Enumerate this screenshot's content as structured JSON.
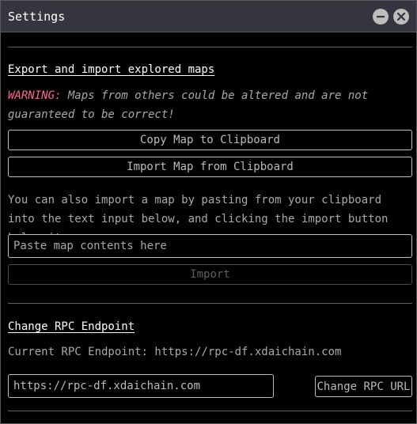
{
  "window": {
    "title": "Settings",
    "minimize_icon": "minus-icon",
    "close_icon": "close-icon"
  },
  "export_section": {
    "heading": "Export and import explored maps",
    "warning_label": "WARNING:",
    "warning_text": " Maps from others could be altered and are not guaranteed to be correct!",
    "copy_button": "Copy Map to Clipboard",
    "import_clipboard_button": "Import Map from Clipboard",
    "instructions": "You can also import a map by pasting from your clipboard into the text input below, and clicking the import button below it.",
    "paste_placeholder": "Paste map contents here",
    "import_button": "Import",
    "import_button_state": "disabled"
  },
  "rpc_section": {
    "heading": "Change RPC Endpoint",
    "current_label": "Current RPC Endpoint: https://rpc-df.xdaichain.com",
    "input_value": "https://rpc-df.xdaichain.com",
    "change_button": "Change RPC URL"
  },
  "colors": {
    "titlebar": "#35353f",
    "warning": "#ff6492",
    "border": "#bfbfbf"
  }
}
